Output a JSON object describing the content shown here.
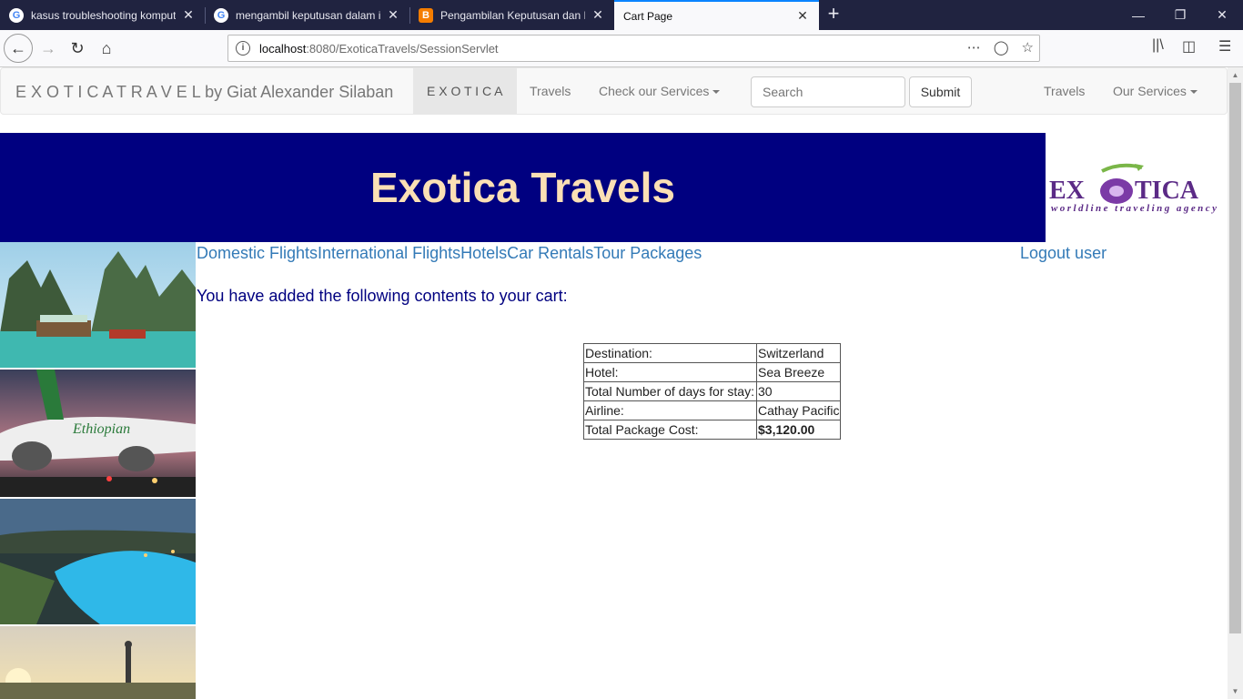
{
  "browser": {
    "tabs": [
      {
        "title": "kasus troubleshooting komputer",
        "favicon": "google-icon"
      },
      {
        "title": "mengambil keputusan dalam i",
        "favicon": "google-icon"
      },
      {
        "title": "Pengambilan Keputusan dan Pe",
        "favicon": "blogger-icon"
      },
      {
        "title": "Cart Page",
        "favicon": "none",
        "active": true
      }
    ],
    "url_host": "localhost",
    "url_rest": ":8080/ExoticaTravels/SessionServlet"
  },
  "navbar": {
    "brand": "E X O T I C A T R A V E L by Giat Alexander Silaban",
    "active_item": "E X O T I C A",
    "travels": "Travels",
    "services_dropdown": "Check our Services",
    "search_placeholder": "Search",
    "submit": "Submit",
    "right_travels": "Travels",
    "right_services": "Our Services"
  },
  "banner": {
    "title": "Exotica Travels",
    "logo_main": "EXOTICA",
    "logo_tagline": "worldline traveling agency"
  },
  "content": {
    "links": [
      "Domestic Flights",
      "International Flights",
      "Hotels",
      "Car Rentals",
      "Tour Packages"
    ],
    "logout": "Logout user",
    "message": "You have added the following contents to your cart:"
  },
  "cart": {
    "rows": [
      {
        "label": "Destination:",
        "value": "Switzerland"
      },
      {
        "label": "Hotel:",
        "value": "Sea Breeze"
      },
      {
        "label": "Total Number of days for stay:",
        "value": "30"
      },
      {
        "label": "Airline:",
        "value": "Cathay Pacific"
      },
      {
        "label": "Total Package Cost:",
        "value": "$3,120.00"
      }
    ]
  },
  "colors": {
    "banner_bg": "#000080",
    "banner_text": "#fbe0b5",
    "link": "#337ab7"
  }
}
